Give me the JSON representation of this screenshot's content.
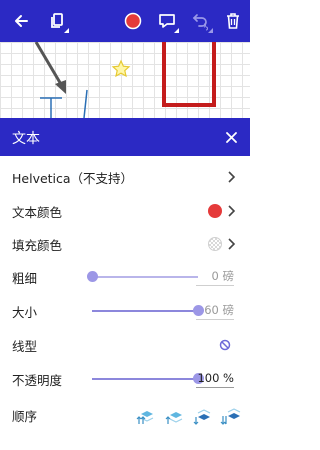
{
  "toolbar": {
    "icons": [
      "back-arrow-icon",
      "copy-icon",
      "color-circle-icon",
      "comment-icon",
      "undo-icon",
      "delete-icon"
    ],
    "accent_color": "#2b29c4"
  },
  "panel": {
    "title": "文本",
    "rows": {
      "font": {
        "label": "Helvetica（不支持）"
      },
      "text_color": {
        "label": "文本颜色",
        "color": "#e53a3a"
      },
      "fill_color": {
        "label": "填充颜色",
        "color": "none"
      },
      "thickness": {
        "label": "粗细",
        "value": "0 磅",
        "slider_fraction": 0
      },
      "size": {
        "label": "大小",
        "value": "60 磅",
        "slider_fraction": 1
      },
      "line_type": {
        "label": "线型"
      },
      "opacity": {
        "label": "不透明度",
        "value": "100 %",
        "slider_fraction": 1
      },
      "order": {
        "label": "顺序"
      }
    }
  }
}
